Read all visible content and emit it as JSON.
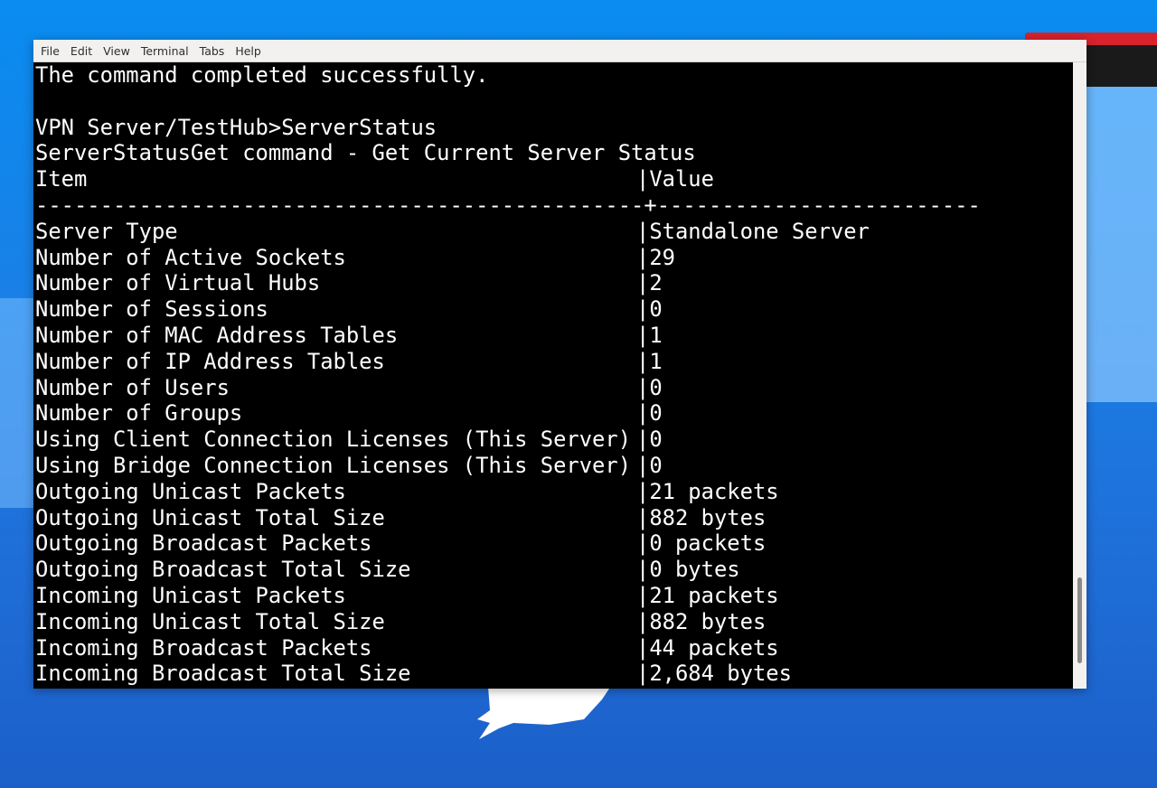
{
  "menu": [
    "File",
    "Edit",
    "View",
    "Terminal",
    "Tabs",
    "Help"
  ],
  "terminal": {
    "status_line": "The command completed successfully.",
    "prompt_line": "VPN Server/TestHub>ServerStatus",
    "command_desc": "ServerStatusGet command - Get Current Server Status",
    "header_item": "Item",
    "header_value": "Value",
    "divider": "-----------------------------------------------+-------------------------",
    "rows": [
      {
        "item": "Server Type",
        "value": "Standalone Server"
      },
      {
        "item": "Number of Active Sockets",
        "value": "29"
      },
      {
        "item": "Number of Virtual Hubs",
        "value": "2"
      },
      {
        "item": "Number of Sessions",
        "value": "0"
      },
      {
        "item": "Number of MAC Address Tables",
        "value": "1"
      },
      {
        "item": "Number of IP Address Tables",
        "value": "1"
      },
      {
        "item": "Number of Users",
        "value": "0"
      },
      {
        "item": "Number of Groups",
        "value": "0"
      },
      {
        "item": "Using Client Connection Licenses (This Server)",
        "value": "0"
      },
      {
        "item": "Using Bridge Connection Licenses (This Server)",
        "value": "0"
      },
      {
        "item": "Outgoing Unicast Packets",
        "value": "21 packets"
      },
      {
        "item": "Outgoing Unicast Total Size",
        "value": "882 bytes"
      },
      {
        "item": "Outgoing Broadcast Packets",
        "value": "0 packets"
      },
      {
        "item": "Outgoing Broadcast Total Size",
        "value": "0 bytes"
      },
      {
        "item": "Incoming Unicast Packets",
        "value": "21 packets"
      },
      {
        "item": "Incoming Unicast Total Size",
        "value": "882 bytes"
      },
      {
        "item": "Incoming Broadcast Packets",
        "value": "44 packets"
      },
      {
        "item": "Incoming Broadcast Total Size",
        "value": "2,684 bytes"
      }
    ]
  },
  "colors": {
    "terminal_bg": "#000000",
    "terminal_fg": "#ffffff",
    "menubar_bg": "#f2f1f0",
    "desktop_bg": "#1a7fe6"
  }
}
